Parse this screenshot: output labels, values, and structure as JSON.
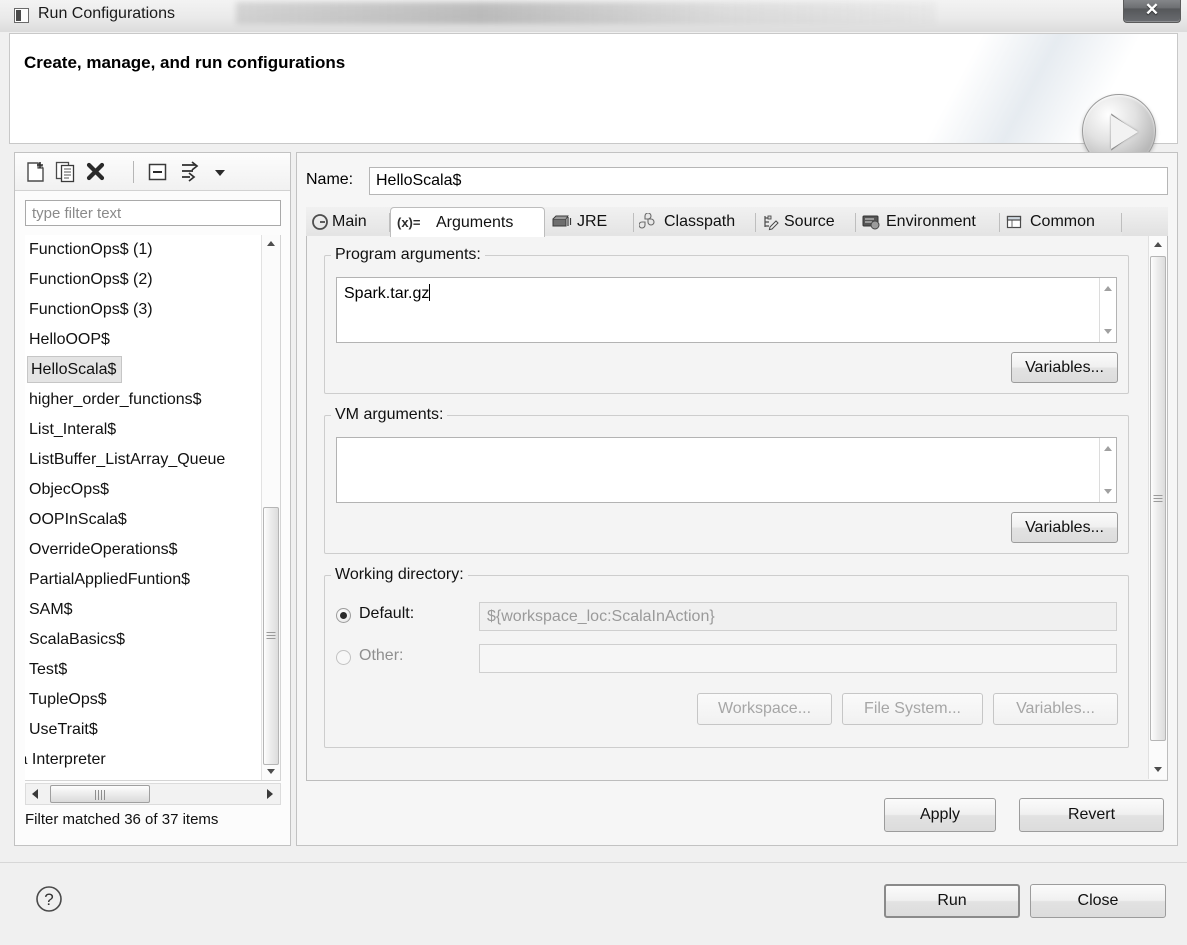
{
  "window": {
    "title": "Run Configurations",
    "close_label": "✕",
    "icon": "window-icon"
  },
  "header": {
    "title": "Create, manage, and run configurations",
    "badge": "run-play-badge"
  },
  "left_panel": {
    "toolbar": [
      {
        "name": "new-configuration-icon",
        "title": "New launch configuration"
      },
      {
        "name": "duplicate-configuration-icon",
        "title": "Duplicate"
      },
      {
        "name": "delete-configuration-icon",
        "title": "Delete"
      },
      {
        "name": "collapse-all-icon",
        "title": "Collapse All"
      },
      {
        "name": "filter-configurations-icon",
        "title": "Filter"
      },
      {
        "name": "chevron-down-icon",
        "title": "Menu"
      }
    ],
    "filter": {
      "placeholder": "type filter text",
      "value": ""
    },
    "items": [
      "FunctionOps$ (1)",
      "FunctionOps$ (2)",
      "FunctionOps$ (3)",
      "HelloOOP$",
      "HelloScala$",
      "higher_order_functions$",
      "List_Interal$",
      "ListBuffer_ListArray_Queue",
      "ObjecOps$",
      "OOPInScala$",
      "OverrideOperations$",
      "PartialAppliedFuntion$",
      "SAM$",
      "ScalaBasics$",
      "Test$",
      "TupleOps$",
      "UseTrait$",
      "la Interpreter"
    ],
    "selected_item": "HelloScala$",
    "status": "Filter matched 36 of 37 items"
  },
  "right_panel": {
    "name_label": "Name:",
    "name_value": "HelloScala$",
    "tabs": [
      {
        "label": "Main",
        "icon": "main-tab-icon",
        "active": false
      },
      {
        "label": "Arguments",
        "icon": "arguments-tab-icon",
        "active": true
      },
      {
        "label": "JRE",
        "icon": "jre-tab-icon",
        "active": false
      },
      {
        "label": "Classpath",
        "icon": "classpath-tab-icon",
        "active": false
      },
      {
        "label": "Source",
        "icon": "source-tab-icon",
        "active": false
      },
      {
        "label": "Environment",
        "icon": "environment-tab-icon",
        "active": false
      },
      {
        "label": "Common",
        "icon": "common-tab-icon",
        "active": false
      }
    ],
    "program_arguments": {
      "legend": "Program arguments:",
      "value": "Spark.tar.gz",
      "variables_button": "Variables..."
    },
    "vm_arguments": {
      "legend": "VM arguments:",
      "value": "",
      "variables_button": "Variables..."
    },
    "working_directory": {
      "legend": "Working directory:",
      "default_label": "Default:",
      "default_value": "${workspace_loc:ScalaInAction}",
      "default_selected": true,
      "other_label": "Other:",
      "other_value": "",
      "other_selected": false,
      "workspace_button": "Workspace...",
      "file_system_button": "File System...",
      "variables_button": "Variables..."
    },
    "apply_button": "Apply",
    "revert_button": "Revert"
  },
  "footer": {
    "help_icon": "help-icon",
    "run_button": "Run",
    "close_button": "Close"
  }
}
